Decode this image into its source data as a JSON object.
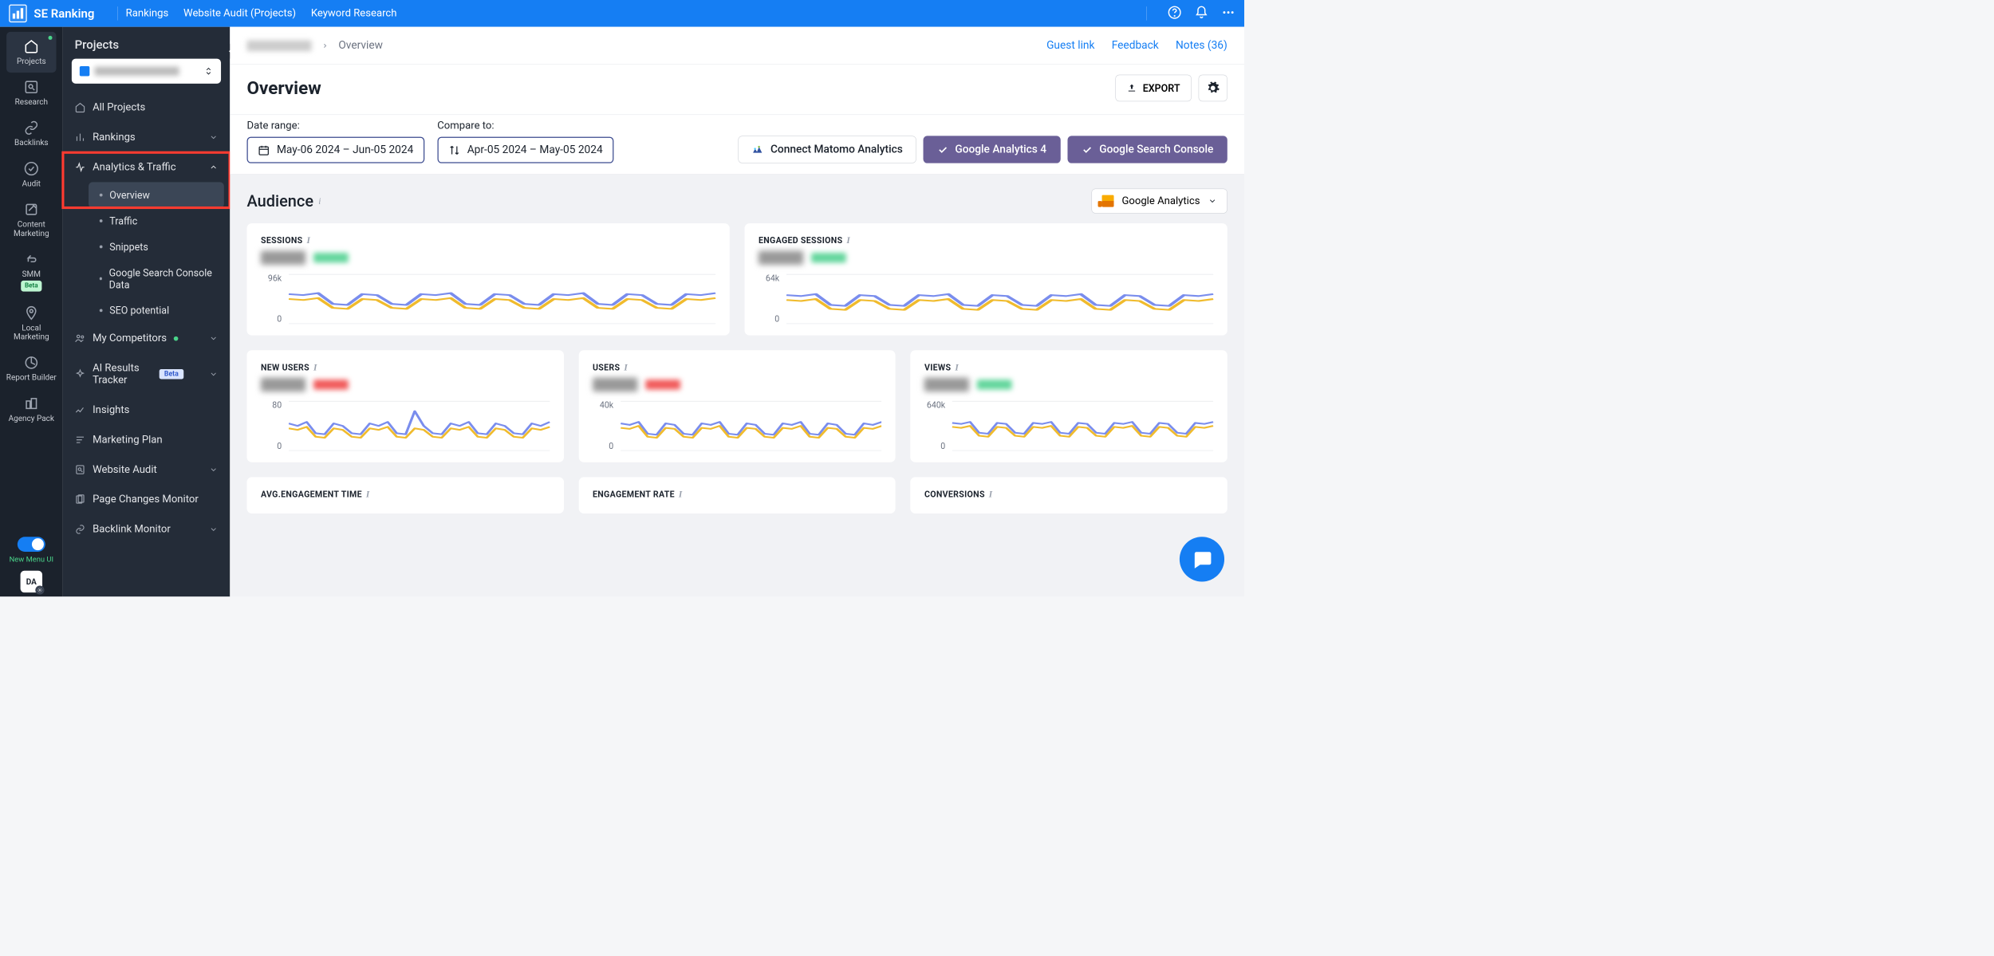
{
  "brand": "SE Ranking",
  "topnav": [
    "Rankings",
    "Website Audit (Projects)",
    "Keyword Research"
  ],
  "rail": {
    "projects": "Projects",
    "research": "Research",
    "backlinks": "Backlinks",
    "audit": "Audit",
    "content_marketing": "Content Marketing",
    "smm": "SMM",
    "beta": "Beta",
    "local_marketing": "Local Marketing",
    "report_builder": "Report Builder",
    "agency_pack": "Agency Pack",
    "toggle": "New Menu UI",
    "da": "DA"
  },
  "sidebar": {
    "header": "Projects",
    "all_projects": "All Projects",
    "rankings": "Rankings",
    "analytics_traffic": "Analytics & Traffic",
    "sub": {
      "overview": "Overview",
      "traffic": "Traffic",
      "snippets": "Snippets",
      "gsc": "Google Search Console Data",
      "seo_potential": "SEO potential"
    },
    "my_competitors": "My Competitors",
    "ai_results": "AI Results Tracker",
    "ai_beta": "Beta",
    "insights": "Insights",
    "marketing_plan": "Marketing Plan",
    "website_audit": "Website Audit",
    "page_changes": "Page Changes Monitor",
    "backlink_monitor": "Backlink Monitor"
  },
  "crumb": {
    "current": "Overview",
    "guest_link": "Guest link",
    "feedback": "Feedback",
    "notes": "Notes (36)"
  },
  "page_title": "Overview",
  "export": "EXPORT",
  "filters": {
    "date_range_lbl": "Date range:",
    "date_range": "May-06 2024 – Jun-05 2024",
    "compare_lbl": "Compare to:",
    "compare_range": "Apr-05 2024 – May-05 2024",
    "connect_matomo": "Connect Matomo Analytics",
    "ga4": "Google Analytics 4",
    "gsc": "Google Search Console"
  },
  "section": {
    "audience": "Audience",
    "ga_select": "Google Analytics"
  },
  "cards": {
    "sessions": "SESSIONS",
    "engaged_sessions": "ENGAGED SESSIONS",
    "new_users": "NEW USERS",
    "users": "USERS",
    "views": "VIEWS",
    "avg_engagement_time": "AVG.ENGAGEMENT TIME",
    "engagement_rate": "ENGAGEMENT RATE",
    "conversions": "CONVERSIONS"
  },
  "chart_data": [
    {
      "name": "sessions",
      "type": "line",
      "ylim": [
        0,
        96000
      ],
      "yticks": [
        "96k",
        "0"
      ],
      "series": [
        {
          "name": "previous",
          "color": "#7a8ded",
          "values": [
            60,
            58,
            62,
            40,
            38,
            60,
            58,
            40,
            38,
            60,
            58,
            62,
            40,
            38,
            60,
            58,
            40,
            38,
            60,
            58,
            62,
            40,
            38,
            60,
            58,
            40,
            38,
            60,
            58,
            62
          ]
        },
        {
          "name": "current",
          "color": "#f0bb2d",
          "values": [
            50,
            48,
            52,
            32,
            30,
            50,
            48,
            32,
            30,
            50,
            48,
            52,
            32,
            30,
            50,
            48,
            32,
            30,
            50,
            48,
            52,
            32,
            30,
            50,
            48,
            32,
            30,
            50,
            48,
            52
          ]
        }
      ]
    },
    {
      "name": "engaged_sessions",
      "type": "line",
      "ylim": [
        0,
        64000
      ],
      "yticks": [
        "64k",
        "0"
      ],
      "series": [
        {
          "name": "previous",
          "color": "#7a8ded",
          "values": [
            58,
            56,
            60,
            38,
            36,
            58,
            56,
            38,
            36,
            58,
            56,
            60,
            38,
            36,
            58,
            56,
            38,
            36,
            58,
            56,
            60,
            38,
            36,
            58,
            56,
            38,
            36,
            58,
            56,
            60
          ]
        },
        {
          "name": "current",
          "color": "#f0bb2d",
          "values": [
            48,
            46,
            50,
            30,
            28,
            48,
            46,
            30,
            28,
            48,
            46,
            50,
            30,
            28,
            48,
            46,
            30,
            28,
            48,
            46,
            50,
            30,
            28,
            48,
            46,
            30,
            28,
            48,
            46,
            50
          ]
        }
      ]
    },
    {
      "name": "new_users",
      "type": "line",
      "ylim": [
        0,
        80
      ],
      "yticks": [
        "80",
        "0"
      ],
      "series": [
        {
          "name": "previous",
          "color": "#7a8ded",
          "values": [
            55,
            50,
            58,
            35,
            33,
            55,
            50,
            35,
            33,
            55,
            50,
            58,
            35,
            33,
            80,
            50,
            35,
            33,
            55,
            50,
            58,
            35,
            33,
            55,
            50,
            35,
            33,
            55,
            50,
            58
          ]
        },
        {
          "name": "current",
          "color": "#f0bb2d",
          "values": [
            45,
            42,
            48,
            28,
            26,
            45,
            42,
            28,
            26,
            45,
            42,
            48,
            28,
            26,
            45,
            42,
            28,
            26,
            45,
            42,
            48,
            28,
            26,
            45,
            42,
            28,
            26,
            45,
            42,
            48
          ]
        }
      ]
    },
    {
      "name": "users",
      "type": "line",
      "ylim": [
        0,
        40000
      ],
      "yticks": [
        "40k",
        "0"
      ],
      "series": [
        {
          "name": "previous",
          "color": "#7a8ded",
          "values": [
            55,
            52,
            58,
            34,
            32,
            55,
            52,
            34,
            32,
            55,
            52,
            58,
            34,
            32,
            55,
            52,
            34,
            32,
            55,
            52,
            58,
            34,
            32,
            55,
            52,
            34,
            32,
            55,
            52,
            58
          ]
        },
        {
          "name": "current",
          "color": "#f0bb2d",
          "values": [
            46,
            44,
            50,
            28,
            26,
            46,
            44,
            28,
            26,
            46,
            44,
            50,
            28,
            26,
            46,
            44,
            28,
            26,
            46,
            44,
            50,
            28,
            26,
            46,
            44,
            28,
            26,
            46,
            44,
            50
          ]
        }
      ]
    },
    {
      "name": "views",
      "type": "line",
      "ylim": [
        0,
        640000
      ],
      "yticks": [
        "640k",
        "0"
      ],
      "series": [
        {
          "name": "previous",
          "color": "#7a8ded",
          "values": [
            56,
            54,
            58,
            36,
            34,
            56,
            54,
            36,
            34,
            56,
            54,
            58,
            36,
            34,
            56,
            54,
            36,
            34,
            56,
            54,
            58,
            36,
            34,
            56,
            54,
            36,
            34,
            56,
            54,
            58
          ]
        },
        {
          "name": "current",
          "color": "#f0bb2d",
          "values": [
            48,
            46,
            50,
            30,
            28,
            48,
            46,
            30,
            28,
            48,
            46,
            50,
            30,
            28,
            48,
            46,
            30,
            28,
            48,
            46,
            50,
            30,
            28,
            48,
            46,
            30,
            28,
            48,
            46,
            50
          ]
        }
      ]
    }
  ]
}
